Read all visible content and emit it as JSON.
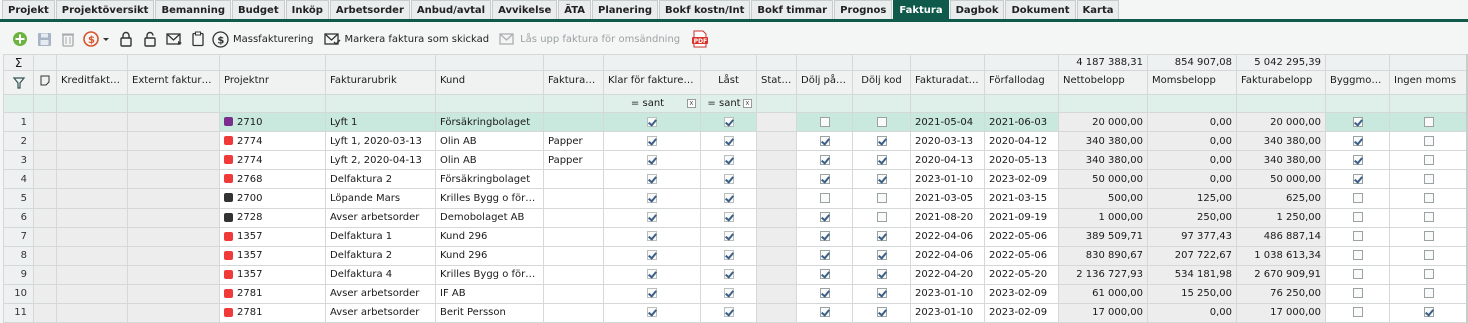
{
  "tabs": [
    {
      "label": "Projekt"
    },
    {
      "label": "Projektöversikt"
    },
    {
      "label": "Bemanning"
    },
    {
      "label": "Budget"
    },
    {
      "label": "Inköp"
    },
    {
      "label": "Arbetsorder"
    },
    {
      "label": "Anbud/avtal"
    },
    {
      "label": "Avvikelse"
    },
    {
      "label": "ÄTA"
    },
    {
      "label": "Planering"
    },
    {
      "label": "Bokf kostn/Int"
    },
    {
      "label": "Bokf timmar"
    },
    {
      "label": "Prognos"
    },
    {
      "label": "Faktura"
    },
    {
      "label": "Dagbok"
    },
    {
      "label": "Dokument"
    },
    {
      "label": "Karta"
    }
  ],
  "active_tab": "Faktura",
  "toolbar": {
    "mass_invoicing": "Massfakturering",
    "mark_sent": "Markera faktura som skickad",
    "unlock_resend": "Lås upp faktura för omsändning",
    "pdf_badge": "PDF"
  },
  "sums": {
    "symbol": "Σ",
    "nettobelopp": "4 187 388,31",
    "momsbelopp": "854 907,08",
    "fakturabelopp": "5 042 295,39"
  },
  "columns": {
    "kreditfaktura": "Kreditfaktura",
    "externt": "Externt fakturanr",
    "projektnr": "Projektnr",
    "fakturarubrik": "Fakturarubrik",
    "kund": "Kund",
    "fakturatyp": "Fakturatyp",
    "klar": "Klar för fakturering",
    "last": "Låst",
    "status": "Status",
    "dolj_paslag": "Dölj påslag",
    "dolj_kod": "Dölj kod",
    "fakturadatum": "Fakturadatum",
    "forfallodag": "Förfallodag",
    "nettobelopp": "Nettobelopp",
    "momsbelopp": "Momsbelopp",
    "fakturabelopp": "Fakturabelopp",
    "byggmoms": "Byggmoms",
    "ingen_moms": "Ingen moms"
  },
  "filters": {
    "klar": "= sant",
    "last": "= sant",
    "clear": "x"
  },
  "colors": {
    "accent": "#0f5a4b",
    "purple": "#7b2d8e",
    "red": "#f03a3a",
    "dark": "#333333"
  },
  "rows": [
    {
      "n": "1",
      "color": "purple",
      "proj": "2710",
      "rubrik": "Lyft 1",
      "kund": "Försäkringbolaget",
      "typ": "",
      "klar": true,
      "last": true,
      "paslag": false,
      "kod": false,
      "fdat": "2021-05-04",
      "forf": "2021-06-03",
      "netto": "20 000,00",
      "moms": "0,00",
      "fbel": "20 000,00",
      "byggmoms": true,
      "ingen": false
    },
    {
      "n": "2",
      "color": "red",
      "proj": "2774",
      "rubrik": "Lyft 1, 2020-03-13",
      "kund": "Olin AB",
      "typ": "Papper",
      "klar": true,
      "last": true,
      "paslag": true,
      "kod": true,
      "fdat": "2020-03-13",
      "forf": "2020-04-12",
      "netto": "340 380,00",
      "moms": "0,00",
      "fbel": "340 380,00",
      "byggmoms": true,
      "ingen": false
    },
    {
      "n": "3",
      "color": "red",
      "proj": "2774",
      "rubrik": "Lyft 2, 2020-04-13",
      "kund": "Olin AB",
      "typ": "Papper",
      "klar": true,
      "last": true,
      "paslag": true,
      "kod": true,
      "fdat": "2020-04-13",
      "forf": "2020-05-13",
      "netto": "340 380,00",
      "moms": "0,00",
      "fbel": "340 380,00",
      "byggmoms": true,
      "ingen": false
    },
    {
      "n": "4",
      "color": "red",
      "proj": "2768",
      "rubrik": "Delfaktura 2",
      "kund": "Försäkringbolaget",
      "typ": "",
      "klar": true,
      "last": true,
      "paslag": true,
      "kod": true,
      "fdat": "2023-01-10",
      "forf": "2023-02-09",
      "netto": "50 000,00",
      "moms": "0,00",
      "fbel": "50 000,00",
      "byggmoms": true,
      "ingen": false
    },
    {
      "n": "5",
      "color": "dark",
      "proj": "2700",
      "rubrik": "Löpande Mars",
      "kund": "Krilles Bygg o förval…",
      "typ": "",
      "klar": true,
      "last": true,
      "paslag": false,
      "kod": false,
      "fdat": "2021-03-05",
      "forf": "2021-03-15",
      "netto": "500,00",
      "moms": "125,00",
      "fbel": "625,00",
      "byggmoms": false,
      "ingen": false
    },
    {
      "n": "6",
      "color": "dark",
      "proj": "2728",
      "rubrik": "Avser arbetsorder",
      "kund": "Demobolaget AB",
      "typ": "",
      "klar": true,
      "last": true,
      "paslag": true,
      "kod": false,
      "fdat": "2021-08-20",
      "forf": "2021-09-19",
      "netto": "1 000,00",
      "moms": "250,00",
      "fbel": "1 250,00",
      "byggmoms": false,
      "ingen": false
    },
    {
      "n": "7",
      "color": "red",
      "proj": "1357",
      "rubrik": "Delfaktura 1",
      "kund": "Kund 296",
      "typ": "",
      "klar": true,
      "last": true,
      "paslag": true,
      "kod": true,
      "fdat": "2022-04-06",
      "forf": "2022-05-06",
      "netto": "389 509,71",
      "moms": "97 377,43",
      "fbel": "486 887,14",
      "byggmoms": false,
      "ingen": false
    },
    {
      "n": "8",
      "color": "red",
      "proj": "1357",
      "rubrik": "Delfaktura 2",
      "kund": "Kund 296",
      "typ": "",
      "klar": true,
      "last": true,
      "paslag": true,
      "kod": true,
      "fdat": "2022-04-06",
      "forf": "2022-05-06",
      "netto": "830 890,67",
      "moms": "207 722,67",
      "fbel": "1 038 613,34",
      "byggmoms": false,
      "ingen": false
    },
    {
      "n": "9",
      "color": "red",
      "proj": "1357",
      "rubrik": "Delfaktura 4",
      "kund": "Krilles Bygg o förval…",
      "typ": "",
      "klar": true,
      "last": true,
      "paslag": true,
      "kod": true,
      "fdat": "2022-04-20",
      "forf": "2022-05-20",
      "netto": "2 136 727,93",
      "moms": "534 181,98",
      "fbel": "2 670 909,91",
      "byggmoms": false,
      "ingen": false
    },
    {
      "n": "10",
      "color": "red",
      "proj": "2781",
      "rubrik": "Avser arbetsorder",
      "kund": "IF AB",
      "typ": "",
      "klar": true,
      "last": true,
      "paslag": true,
      "kod": true,
      "fdat": "2023-01-10",
      "forf": "2023-02-09",
      "netto": "61 000,00",
      "moms": "15 250,00",
      "fbel": "76 250,00",
      "byggmoms": false,
      "ingen": false
    },
    {
      "n": "11",
      "color": "red",
      "proj": "2781",
      "rubrik": "Avser arbetsorder",
      "kund": "Berit Persson",
      "typ": "",
      "klar": true,
      "last": true,
      "paslag": true,
      "kod": true,
      "fdat": "2023-01-10",
      "forf": "2023-02-09",
      "netto": "17 000,00",
      "moms": "0,00",
      "fbel": "17 000,00",
      "byggmoms": false,
      "ingen": true
    }
  ]
}
